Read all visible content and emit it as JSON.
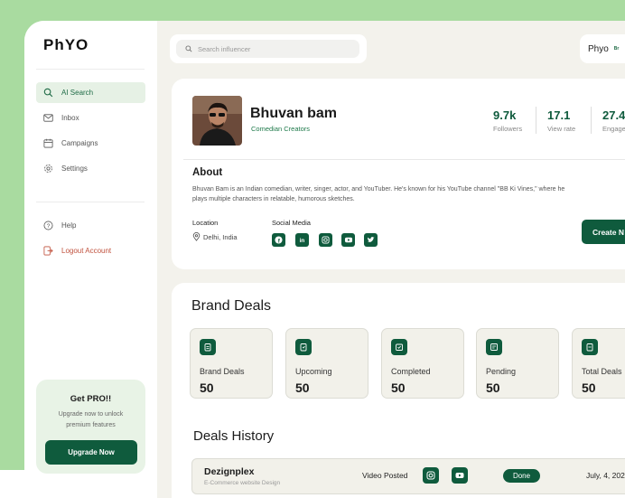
{
  "app": {
    "logo": "PhYO"
  },
  "sidebar": {
    "items": [
      {
        "label": "AI Search",
        "icon": "search-icon"
      },
      {
        "label": "Inbox",
        "icon": "mail-icon"
      },
      {
        "label": "Campaigns",
        "icon": "calendar-icon"
      },
      {
        "label": "Settings",
        "icon": "gear-icon"
      },
      {
        "label": "Help",
        "icon": "help-icon"
      },
      {
        "label": "Logout Account",
        "icon": "logout-icon"
      }
    ],
    "pro": {
      "title": "Get PRO!!",
      "subtitle": "Upgrade now to unlock premium features",
      "button": "Upgrade Now"
    }
  },
  "search": {
    "placeholder": "Search influencer"
  },
  "user": {
    "name": "Phyo",
    "tag": "Br"
  },
  "profile": {
    "name": "Bhuvan bam",
    "category": "Comedian Creators",
    "stats": [
      {
        "value": "9.7k",
        "label": "Followers"
      },
      {
        "value": "17.1",
        "label": "View rate"
      },
      {
        "value": "27.4",
        "label": "Engage"
      }
    ],
    "about_title": "About",
    "about_text": "Bhuvan Bam is an Indian comedian, writer, singer, actor, and YouTuber. He's known for his YouTube channel \"BB Ki Vines,\" where he plays multiple characters in relatable, humorous sketches.",
    "location_label": "Location",
    "location_value": "Delhi, India",
    "social_label": "Social Media",
    "social": [
      "facebook-icon",
      "linkedin-icon",
      "instagram-icon",
      "youtube-icon",
      "twitter-icon"
    ],
    "create_button": "Create N"
  },
  "deals": {
    "title": "Brand Deals",
    "tiles": [
      {
        "label": "Brand Deals",
        "value": "50"
      },
      {
        "label": "Upcoming",
        "value": "50"
      },
      {
        "label": "Completed",
        "value": "50"
      },
      {
        "label": "Pending",
        "value": "50"
      },
      {
        "label": "Total Deals",
        "value": "50"
      }
    ],
    "history_title": "Deals History",
    "history": [
      {
        "brand": "Dezignplex",
        "sub": "E-Commerce website Design",
        "type": "Video Posted",
        "status": "Done",
        "date": "July, 4, 202"
      }
    ]
  },
  "colors": {
    "accent": "#0f5b3d",
    "background": "#a9dba0",
    "panel": "#f3f2ec"
  }
}
